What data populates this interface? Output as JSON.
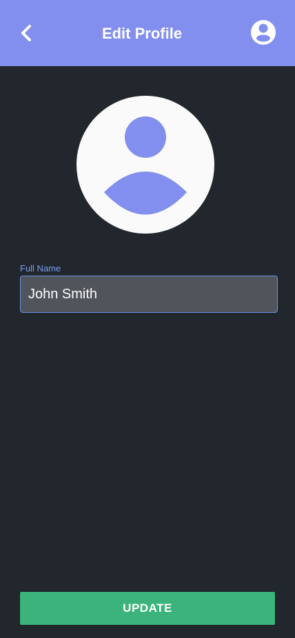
{
  "header": {
    "title": "Edit Profile",
    "back_icon": "chevron-left-icon",
    "account_icon": "account-circle-icon",
    "background_color": "#838fee"
  },
  "avatar": {
    "icon": "user-avatar-icon",
    "color": "#838fee"
  },
  "form": {
    "full_name": {
      "label": "Full Name",
      "value": "John Smith"
    }
  },
  "actions": {
    "update_label": "UPDATE",
    "update_color": "#3bb37b"
  }
}
